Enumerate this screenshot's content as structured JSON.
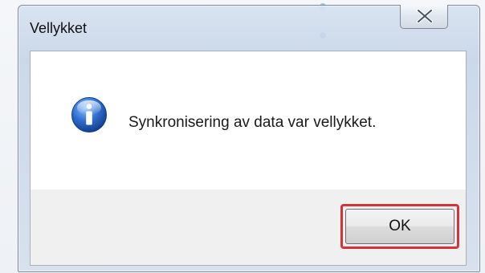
{
  "window": {
    "title": "Vellykket",
    "close_icon": "close-x-icon"
  },
  "dialog": {
    "icon": "information-icon",
    "message": "Synkronisering av data var vellykket.",
    "ok_label": "OK"
  },
  "colors": {
    "highlight": "#d3333b",
    "info_blue": "#2f6fd0"
  }
}
